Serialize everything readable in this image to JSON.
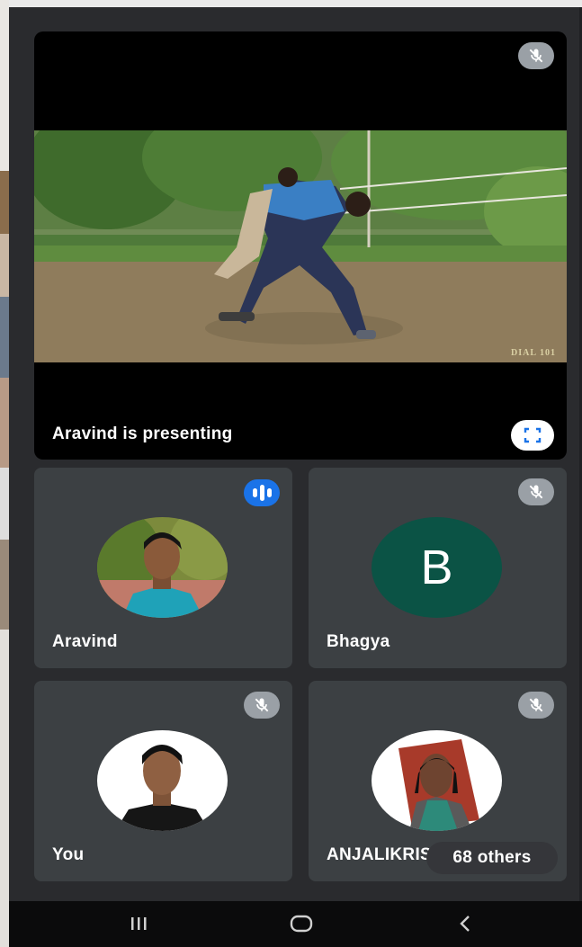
{
  "presentation": {
    "label": "Aravind is presenting",
    "watermark": "DIAL 101",
    "fullscreen_icon": "fullscreen-icon",
    "mic_icon": "mic-off-icon"
  },
  "participants": [
    {
      "name": "Aravind",
      "status": "speaking",
      "avatar": "photo"
    },
    {
      "name": "Bhagya",
      "status": "muted",
      "avatar_initial": "B",
      "avatar_color": "#0b5345"
    },
    {
      "name": "You",
      "status": "muted",
      "avatar": "photo"
    },
    {
      "name": "ANJALIKRISHNA",
      "status": "muted",
      "avatar": "photo"
    }
  ],
  "others": {
    "label": "68 others"
  },
  "nav": {
    "recents_icon": "recents-icon",
    "home_icon": "home-icon",
    "back_icon": "back-icon"
  },
  "colors": {
    "background": "#202124",
    "tile": "#3c4043",
    "speaking": "#1a73e8",
    "muted": "#9aa0a6"
  }
}
